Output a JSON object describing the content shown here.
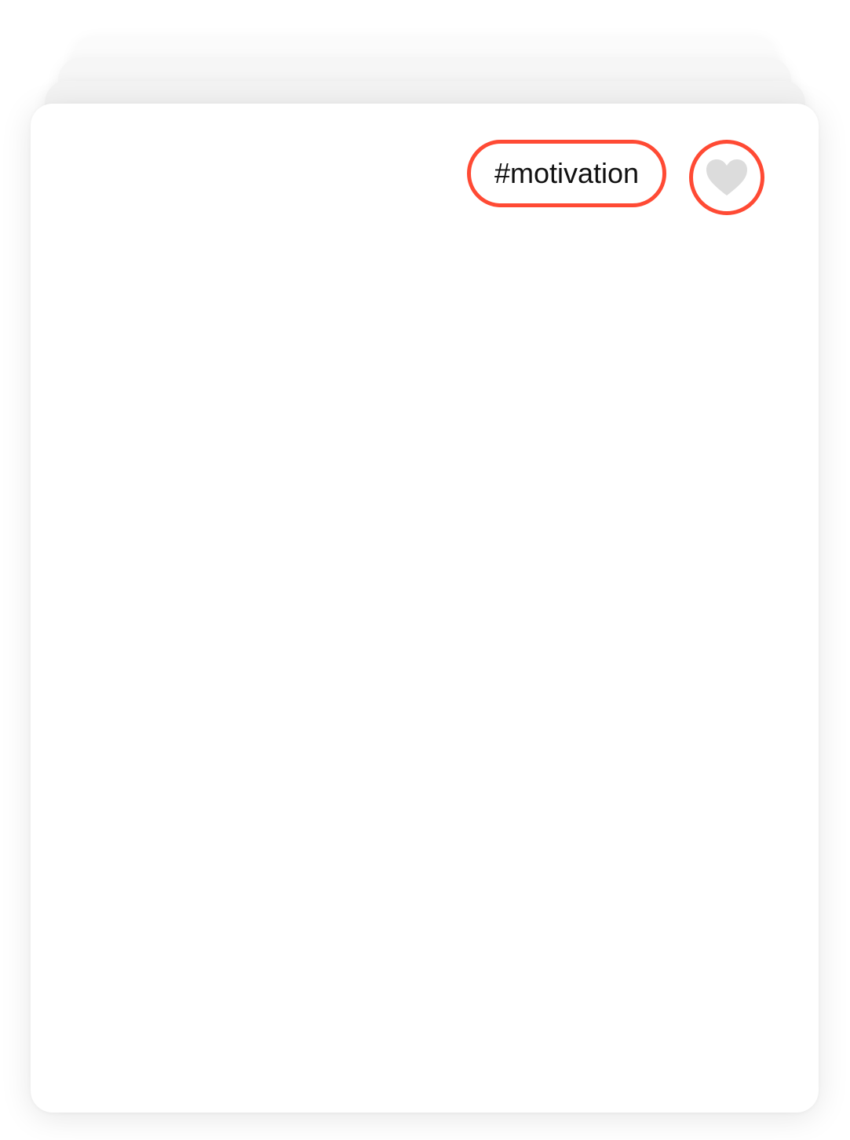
{
  "card": {
    "tag_label": "#motivation",
    "like_icon": "heart-icon",
    "like_state": "inactive"
  },
  "colors": {
    "accent": "#ff4a34",
    "heart_inactive": "#dcdcdc",
    "card_background": "#ffffff",
    "text": "#111111"
  }
}
